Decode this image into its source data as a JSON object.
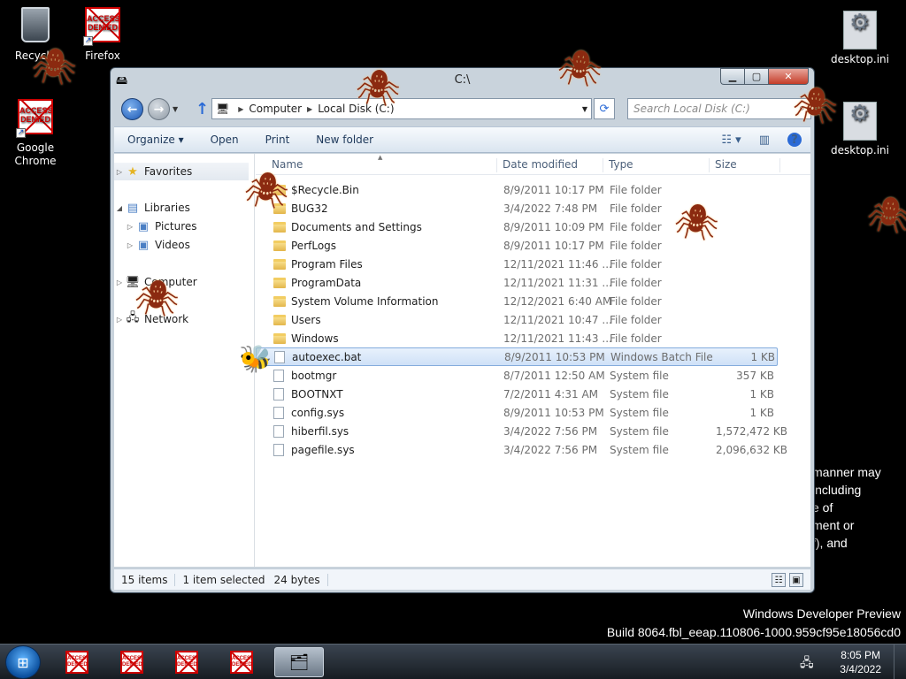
{
  "desktop": {
    "icons": [
      {
        "label": "Recycle"
      },
      {
        "label": "Firefox"
      },
      {
        "label": "Google Chrome"
      },
      {
        "label": "desktop.ini"
      },
      {
        "label": "desktop.ini"
      }
    ],
    "access_denied_text": "ACCESS DENIED",
    "background_lines": [
      "manner may",
      "including",
      "e of",
      "ment or",
      "f), and"
    ],
    "watermark": {
      "line1": "Windows Developer Preview",
      "line2": "Build 8064.fbl_eeap.110806-1000.959cf95e18056cd0"
    }
  },
  "window": {
    "title": "C:\\",
    "address": {
      "crumb1": "Computer",
      "crumb2": "Local Disk (C:)"
    },
    "search_placeholder": "Search Local Disk (C:)",
    "toolbar": {
      "organize": "Organize ▾",
      "open": "Open",
      "print": "Print",
      "new_folder": "New folder"
    },
    "nav": {
      "favorites": "Favorites",
      "libraries": "Libraries",
      "pictures": "Pictures",
      "videos": "Videos",
      "computer": "Computer",
      "network": "Network"
    },
    "columns": {
      "name": "Name",
      "date": "Date modified",
      "type": "Type",
      "size": "Size"
    },
    "files": [
      {
        "name": "$Recycle.Bin",
        "date": "8/9/2011 10:17 PM",
        "type": "File folder",
        "size": "",
        "kind": "folder"
      },
      {
        "name": "BUG32",
        "date": "3/4/2022 7:48 PM",
        "type": "File folder",
        "size": "",
        "kind": "folder"
      },
      {
        "name": "Documents and Settings",
        "date": "8/9/2011 10:09 PM",
        "type": "File folder",
        "size": "",
        "kind": "folder"
      },
      {
        "name": "PerfLogs",
        "date": "8/9/2011 10:17 PM",
        "type": "File folder",
        "size": "",
        "kind": "folder"
      },
      {
        "name": "Program Files",
        "date": "12/11/2021 11:46 ...",
        "type": "File folder",
        "size": "",
        "kind": "folder"
      },
      {
        "name": "ProgramData",
        "date": "12/11/2021 11:31 ...",
        "type": "File folder",
        "size": "",
        "kind": "folder"
      },
      {
        "name": "System Volume Information",
        "date": "12/12/2021 6:40 AM",
        "type": "File folder",
        "size": "",
        "kind": "folder"
      },
      {
        "name": "Users",
        "date": "12/11/2021 10:47 ...",
        "type": "File folder",
        "size": "",
        "kind": "folder"
      },
      {
        "name": "Windows",
        "date": "12/11/2021 11:43 ...",
        "type": "File folder",
        "size": "",
        "kind": "folder"
      },
      {
        "name": "autoexec.bat",
        "date": "8/9/2011 10:53 PM",
        "type": "Windows Batch File",
        "size": "1 KB",
        "kind": "file",
        "selected": true
      },
      {
        "name": "bootmgr",
        "date": "8/7/2011 12:50 AM",
        "type": "System file",
        "size": "357 KB",
        "kind": "file"
      },
      {
        "name": "BOOTNXT",
        "date": "7/2/2011 4:31 AM",
        "type": "System file",
        "size": "1 KB",
        "kind": "file"
      },
      {
        "name": "config.sys",
        "date": "8/9/2011 10:53 PM",
        "type": "System file",
        "size": "1 KB",
        "kind": "file"
      },
      {
        "name": "hiberfil.sys",
        "date": "3/4/2022 7:56 PM",
        "type": "System file",
        "size": "1,572,472 KB",
        "kind": "file"
      },
      {
        "name": "pagefile.sys",
        "date": "3/4/2022 7:56 PM",
        "type": "System file",
        "size": "2,096,632 KB",
        "kind": "file"
      }
    ],
    "status": {
      "items": "15 items",
      "selected": "1 item selected",
      "bytes": "24 bytes"
    }
  },
  "taskbar": {
    "time": "8:05 PM",
    "date": "3/4/2022"
  },
  "icons": {
    "spider": "spider-icon",
    "bee": "bee-icon",
    "folder": "folder-icon",
    "file": "file-icon"
  },
  "colors": {
    "selection": "#cfe1f7",
    "folder": "#e3b64a",
    "start": "#0b4f9d"
  }
}
